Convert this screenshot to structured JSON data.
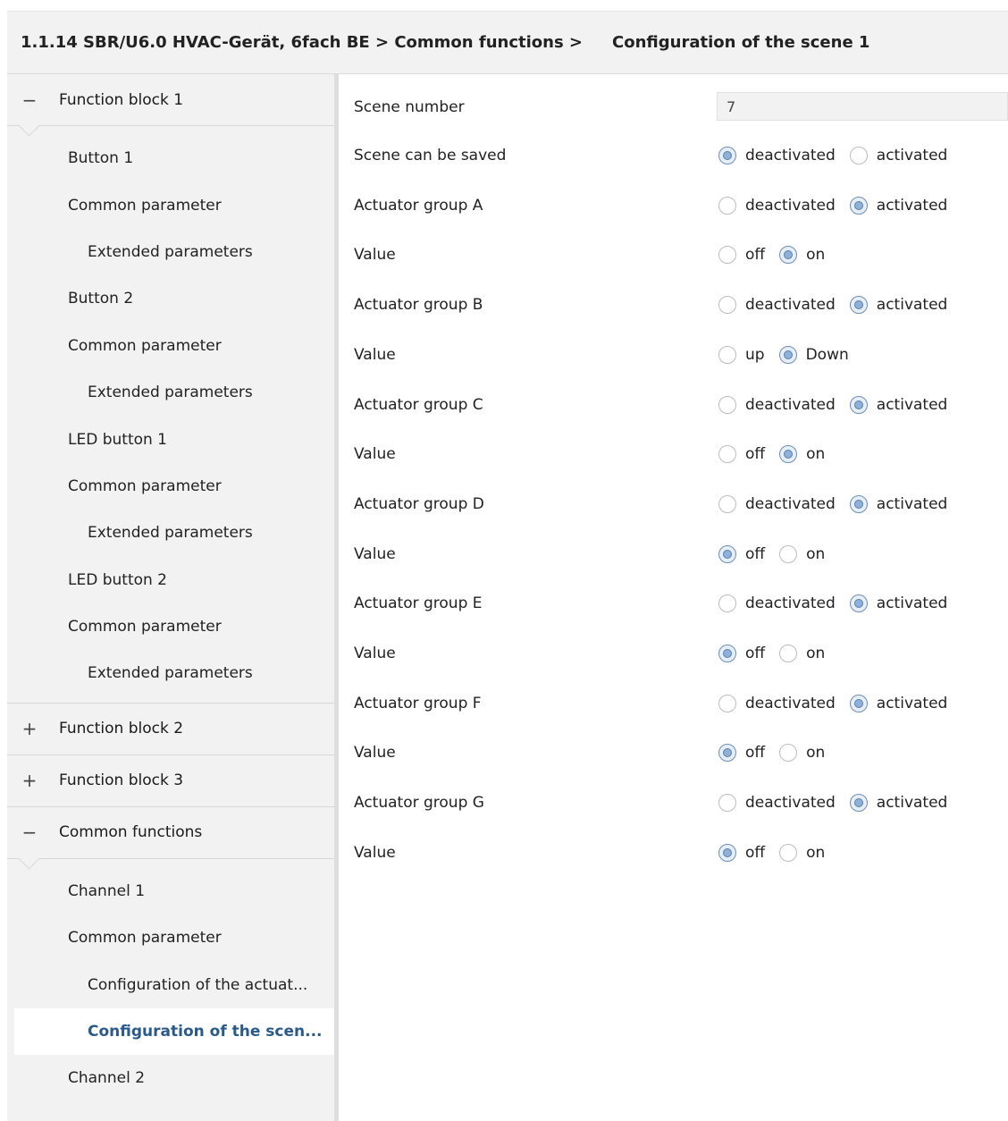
{
  "header": {
    "breadcrumb": "1.1.14 SBR/U6.0 HVAC-Gerät, 6fach BE > Common functions >",
    "title": "Configuration of the scene 1"
  },
  "sidebar": {
    "groups": [
      {
        "sign": "−",
        "label": "Function block 1",
        "items": [
          {
            "label": "Button 1"
          },
          {
            "label": "Common parameter"
          },
          {
            "label": "Extended parameters"
          },
          {
            "label": "Button 2"
          },
          {
            "label": "Common parameter"
          },
          {
            "label": "Extended parameters"
          },
          {
            "label": "LED button 1"
          },
          {
            "label": "Common parameter"
          },
          {
            "label": "Extended parameters"
          },
          {
            "label": "LED button 2"
          },
          {
            "label": "Common parameter"
          },
          {
            "label": "Extended parameters"
          }
        ]
      },
      {
        "sign": "+",
        "label": "Function block 2"
      },
      {
        "sign": "+",
        "label": "Function block 3"
      },
      {
        "sign": "−",
        "label": "Common functions",
        "items": [
          {
            "label": "Channel 1"
          },
          {
            "label": "Common parameter"
          },
          {
            "label": "Configuration of the actuat..."
          },
          {
            "label": "Configuration of the scen..."
          },
          {
            "label": "Channel 2"
          }
        ]
      }
    ]
  },
  "params": {
    "scene_number": {
      "label": "Scene number",
      "value": "7"
    },
    "rows": [
      {
        "label": "Scene can be saved",
        "options": [
          "deactivated",
          "activated"
        ],
        "selected": 0
      },
      {
        "label": "Actuator group A",
        "options": [
          "deactivated",
          "activated"
        ],
        "selected": 1
      },
      {
        "label": "Value",
        "options": [
          "off",
          "on"
        ],
        "selected": 1
      },
      {
        "label": "Actuator group B",
        "options": [
          "deactivated",
          "activated"
        ],
        "selected": 1
      },
      {
        "label": "Value",
        "options": [
          "up",
          "Down"
        ],
        "selected": 1
      },
      {
        "label": "Actuator group C",
        "options": [
          "deactivated",
          "activated"
        ],
        "selected": 1
      },
      {
        "label": "Value",
        "options": [
          "off",
          "on"
        ],
        "selected": 1
      },
      {
        "label": "Actuator group D",
        "options": [
          "deactivated",
          "activated"
        ],
        "selected": 1
      },
      {
        "label": "Value",
        "options": [
          "off",
          "on"
        ],
        "selected": 0
      },
      {
        "label": "Actuator group E",
        "options": [
          "deactivated",
          "activated"
        ],
        "selected": 1
      },
      {
        "label": "Value",
        "options": [
          "off",
          "on"
        ],
        "selected": 0
      },
      {
        "label": "Actuator group F",
        "options": [
          "deactivated",
          "activated"
        ],
        "selected": 1
      },
      {
        "label": "Value",
        "options": [
          "off",
          "on"
        ],
        "selected": 0
      },
      {
        "label": "Actuator group G",
        "options": [
          "deactivated",
          "activated"
        ],
        "selected": 1
      },
      {
        "label": "Value",
        "options": [
          "off",
          "on"
        ],
        "selected": 0
      }
    ]
  }
}
